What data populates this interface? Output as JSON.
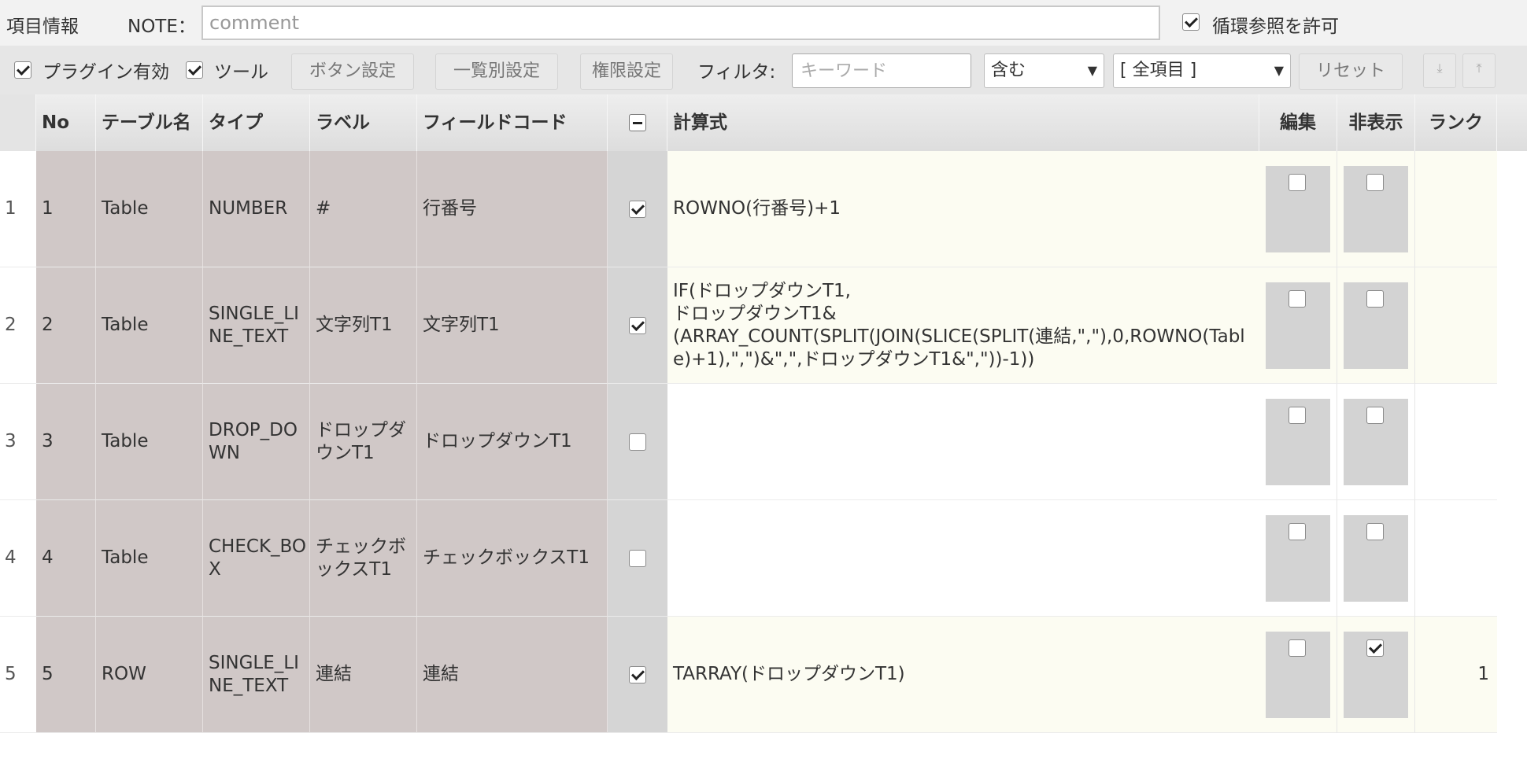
{
  "header": {
    "title": "項目情報",
    "note_label": "NOTE：",
    "note_placeholder": "comment",
    "circular_label": "循環参照を許可",
    "circular_checked": true
  },
  "toolbar": {
    "plugin_label": "プラグイン有効",
    "tool_label": "ツール",
    "button_settings": "ボタン設定",
    "list_settings": "一覧別設定",
    "permission_settings": "権限設定",
    "filter_label": "フィルタ:",
    "keyword_placeholder": "キーワード",
    "match_select": "含む",
    "field_select": "[ 全項目 ]",
    "reset": "リセット",
    "move_bottom_icon": "move-to-bottom-icon",
    "move_top_icon": "move-to-top-icon"
  },
  "table": {
    "headers": {
      "no": "No",
      "table_name": "テーブル名",
      "type": "タイプ",
      "label": "ラベル",
      "field_code": "フィールドコード",
      "formula": "計算式",
      "edit": "編集",
      "hidden": "非表示",
      "rank": "ランク"
    },
    "rows": [
      {
        "rownum": "1",
        "no": "1",
        "table": "Table",
        "type": "NUMBER",
        "label": "#",
        "code": "行番号",
        "enabled": true,
        "formula": "ROWNO(行番号)+1",
        "edit": false,
        "hidden": false,
        "rank": ""
      },
      {
        "rownum": "2",
        "no": "2",
        "table": "Table",
        "type": "SINGLE_LINE_TEXT",
        "label": "文字列T1",
        "code": "文字列T1",
        "enabled": true,
        "formula": "IF(ドロップダウンT1,\nドロップダウンT1&\n(ARRAY_COUNT(SPLIT(JOIN(SLICE(SPLIT(連結,\",\"),0,ROWNO(Table)+1),\",\")&\",\",ドロップダウンT1&\",\"))-1))",
        "edit": false,
        "hidden": false,
        "rank": ""
      },
      {
        "rownum": "3",
        "no": "3",
        "table": "Table",
        "type": "DROP_DOWN",
        "label": "ドロップダウンT1",
        "code": "ドロップダウンT1",
        "enabled": false,
        "formula": "",
        "edit": false,
        "hidden": false,
        "rank": ""
      },
      {
        "rownum": "4",
        "no": "4",
        "table": "Table",
        "type": "CHECK_BOX",
        "label": "チェックボックスT1",
        "code": "チェックボックスT1",
        "enabled": false,
        "formula": "",
        "edit": false,
        "hidden": false,
        "rank": ""
      },
      {
        "rownum": "5",
        "no": "5",
        "table": "ROW",
        "type": "SINGLE_LINE_TEXT",
        "label": "連結",
        "code": "連結",
        "enabled": true,
        "formula": "TARRAY(ドロップダウンT1)",
        "edit": false,
        "hidden": true,
        "rank": "1"
      }
    ]
  }
}
